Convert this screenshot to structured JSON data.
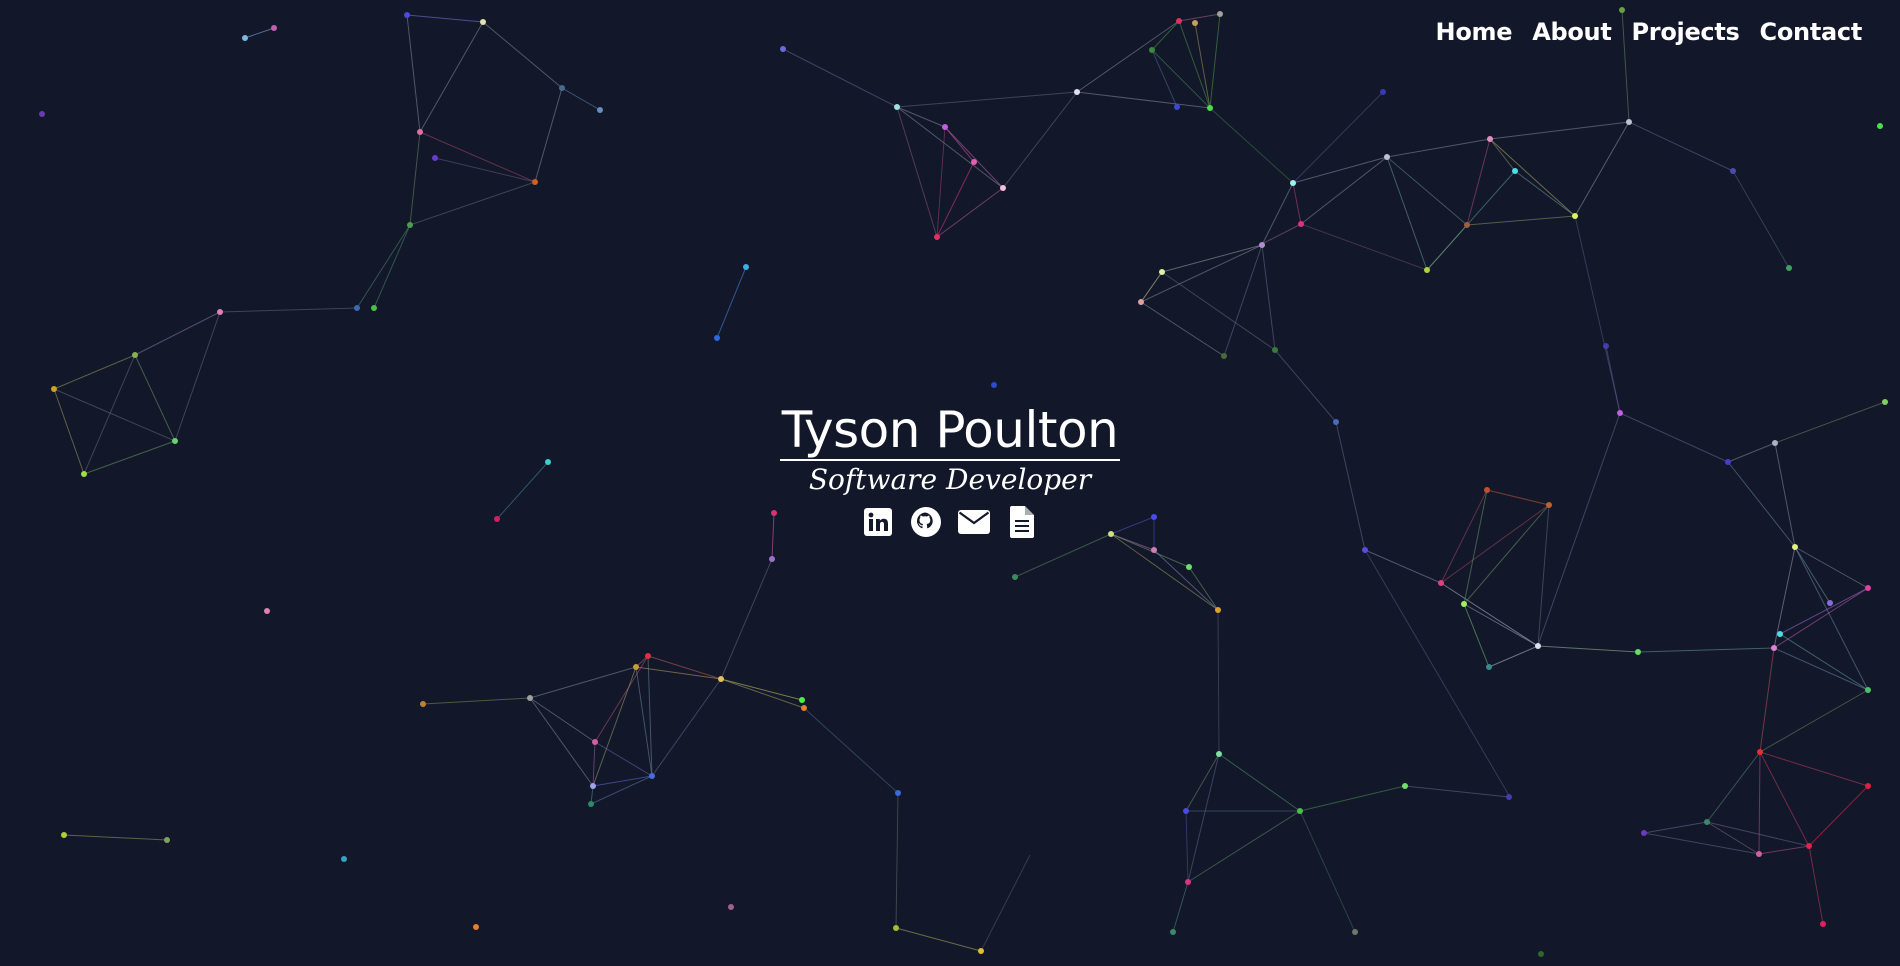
{
  "nav": {
    "items": [
      {
        "label": "Home"
      },
      {
        "label": "About"
      },
      {
        "label": "Projects"
      },
      {
        "label": "Contact"
      }
    ]
  },
  "hero": {
    "name": "Tyson Poulton",
    "subtitle": "Software Developer"
  },
  "social": [
    {
      "icon": "linkedin-icon"
    },
    {
      "icon": "github-icon"
    },
    {
      "icon": "envelope-icon"
    },
    {
      "icon": "document-icon"
    }
  ],
  "theme": {
    "background": "#121729",
    "text": "#ffffff"
  }
}
